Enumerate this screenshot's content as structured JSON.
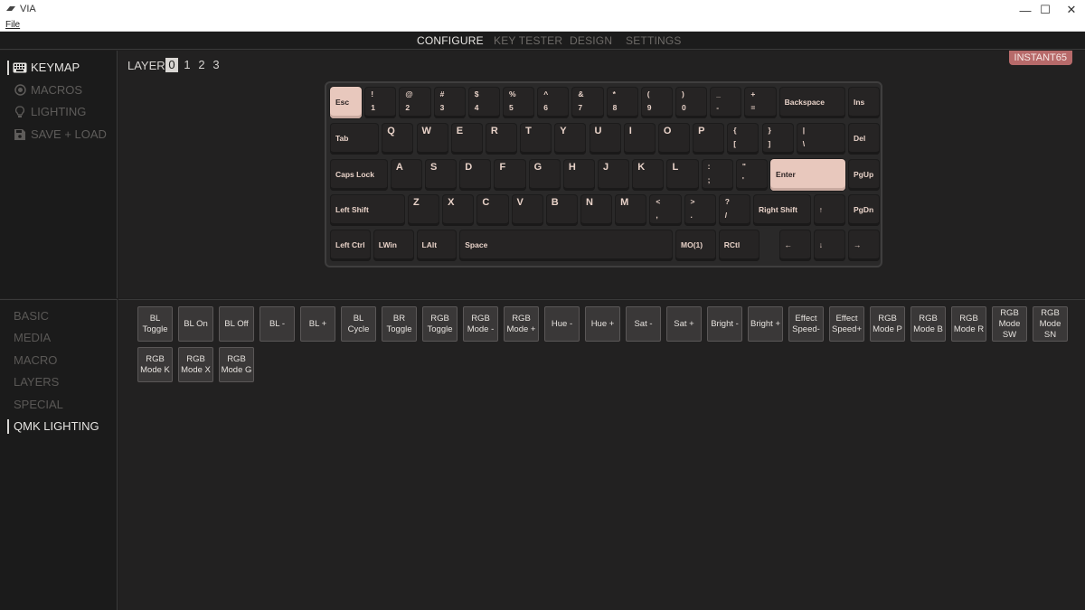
{
  "window": {
    "title": "VIA",
    "menu_file": "File",
    "minimize": "—",
    "maximize": "☐",
    "close": "✕"
  },
  "topnav": {
    "tabs": [
      "CONFIGURE",
      "KEY TESTER",
      "DESIGN",
      "SETTINGS"
    ],
    "active": "CONFIGURE"
  },
  "sidebar": {
    "items": [
      "KEYMAP",
      "MACROS",
      "LIGHTING",
      "SAVE + LOAD"
    ]
  },
  "layer": {
    "label": "LAYER",
    "numbers": [
      "0",
      "1",
      "2",
      "3"
    ],
    "active": "0"
  },
  "device": {
    "name": "INSTANT65"
  },
  "keyboard": {
    "rows": [
      [
        {
          "l": "Esc",
          "hl": true
        },
        {
          "t": "!",
          "b": "1"
        },
        {
          "t": "@",
          "b": "2"
        },
        {
          "t": "#",
          "b": "3"
        },
        {
          "t": "$",
          "b": "4"
        },
        {
          "t": "%",
          "b": "5"
        },
        {
          "t": "^",
          "b": "6"
        },
        {
          "t": "&",
          "b": "7"
        },
        {
          "t": "*",
          "b": "8"
        },
        {
          "t": "(",
          "b": "9"
        },
        {
          "t": ")",
          "b": "0"
        },
        {
          "t": "_",
          "b": "-"
        },
        {
          "t": "+",
          "b": "="
        },
        {
          "l": "Backspace"
        },
        {
          "l": "Ins"
        }
      ],
      [
        {
          "l": "Tab"
        },
        {
          "c": "Q"
        },
        {
          "c": "W"
        },
        {
          "c": "E"
        },
        {
          "c": "R"
        },
        {
          "c": "T"
        },
        {
          "c": "Y"
        },
        {
          "c": "U"
        },
        {
          "c": "I"
        },
        {
          "c": "O"
        },
        {
          "c": "P"
        },
        {
          "t": "{",
          "b": "["
        },
        {
          "t": "}",
          "b": "]"
        },
        {
          "t": "|",
          "b": "\\"
        },
        {
          "l": "Del"
        }
      ],
      [
        {
          "l": "Caps Lock"
        },
        {
          "c": "A"
        },
        {
          "c": "S"
        },
        {
          "c": "D"
        },
        {
          "c": "F"
        },
        {
          "c": "G"
        },
        {
          "c": "H"
        },
        {
          "c": "J"
        },
        {
          "c": "K"
        },
        {
          "c": "L"
        },
        {
          "t": ":",
          "b": ";"
        },
        {
          "t": "\"",
          "b": "'"
        },
        {
          "l": "Enter",
          "hl": true
        },
        {
          "l": "PgUp"
        }
      ],
      [
        {
          "l": "Left Shift"
        },
        {
          "c": "Z"
        },
        {
          "c": "X"
        },
        {
          "c": "C"
        },
        {
          "c": "V"
        },
        {
          "c": "B"
        },
        {
          "c": "N"
        },
        {
          "c": "M"
        },
        {
          "t": "<",
          "b": ","
        },
        {
          "t": ">",
          "b": "."
        },
        {
          "t": "?",
          "b": "/"
        },
        {
          "l": "Right Shift"
        },
        {
          "l": "↑"
        },
        {
          "l": "PgDn"
        }
      ],
      [
        {
          "l": "Left Ctrl"
        },
        {
          "l": "LWin"
        },
        {
          "l": "LAlt"
        },
        {
          "l": "Space"
        },
        {
          "l": "MO(1)"
        },
        {
          "l": "RCtl"
        },
        {
          "l": "←"
        },
        {
          "l": "↓"
        },
        {
          "l": "→"
        }
      ]
    ]
  },
  "categories": {
    "items": [
      "BASIC",
      "MEDIA",
      "MACRO",
      "LAYERS",
      "SPECIAL",
      "QMK LIGHTING"
    ],
    "active": "QMK LIGHTING"
  },
  "keycodes": [
    "BL\nToggle",
    "BL On",
    "BL Off",
    "BL -",
    "BL +",
    "BL Cycle",
    "BR\nToggle",
    "RGB\nToggle",
    "RGB\nMode -",
    "RGB\nMode +",
    "Hue -",
    "Hue +",
    "Sat -",
    "Sat +",
    "Bright -",
    "Bright +",
    "Effect\nSpeed-",
    "Effect\nSpeed+",
    "RGB\nMode P",
    "RGB\nMode B",
    "RGB\nMode R",
    "RGB\nMode\nSW",
    "RGB\nMode\nSN",
    "RGB\nMode K",
    "RGB\nMode X",
    "RGB\nMode G"
  ]
}
